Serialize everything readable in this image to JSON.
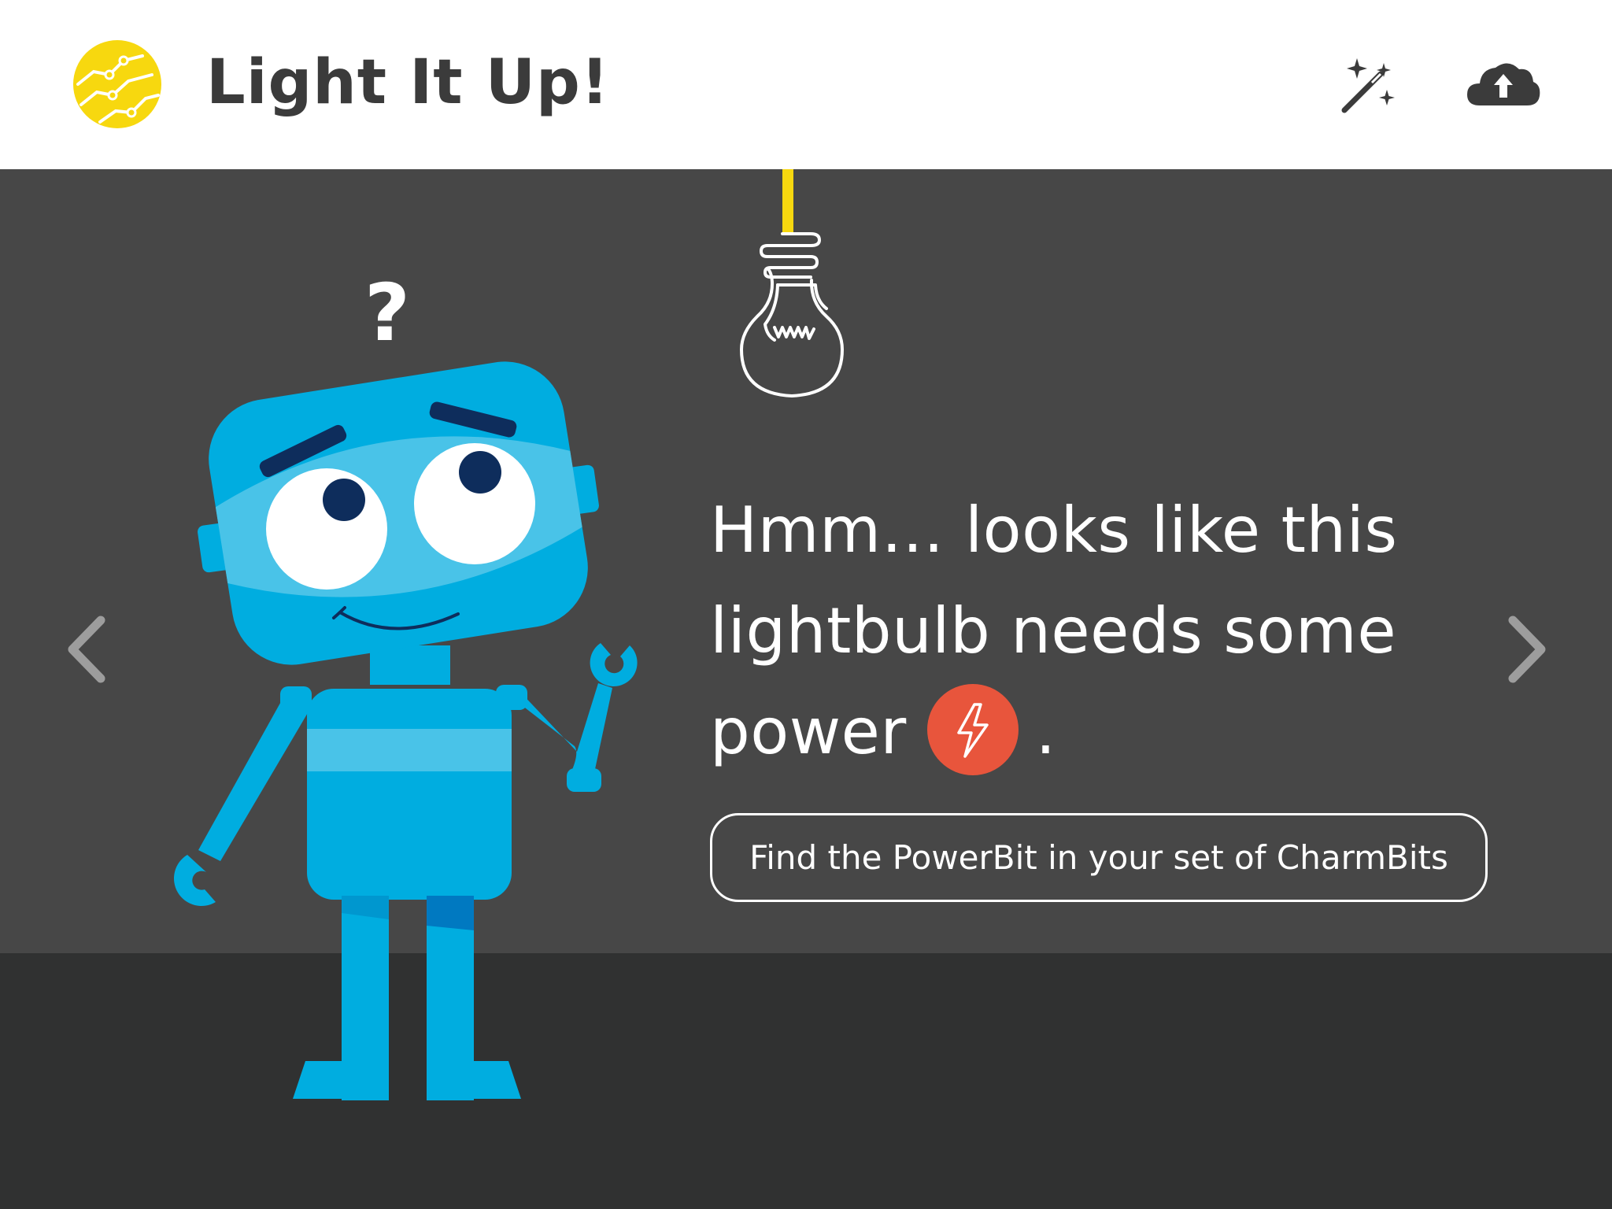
{
  "header": {
    "title": "Light It Up!",
    "logo_icon": "circuit-logo-icon",
    "magic_wand_icon": "magic-wand-icon",
    "cloud_upload_icon": "cloud-upload-icon"
  },
  "question_mark": "?",
  "message": {
    "line1": "Hmm… looks like this",
    "line2": "lightbulb needs some",
    "line3": "power",
    "after_badge": ".",
    "badge_icon": "lightning-bolt-icon"
  },
  "hint_button_label": "Find the PowerBit in your set of CharmBits",
  "navigation": {
    "prev_icon": "chevron-left-icon",
    "next_icon": "chevron-right-icon"
  },
  "colors": {
    "logo_yellow": "#f7d80f",
    "wire_yellow": "#f7d80f",
    "stage": "#474747",
    "floor": "#303131",
    "robot_blue": "#00ade0",
    "robot_light_blue": "#49c3e8",
    "robot_dark": "#0e2d5c",
    "power_badge": "#e8553c"
  }
}
